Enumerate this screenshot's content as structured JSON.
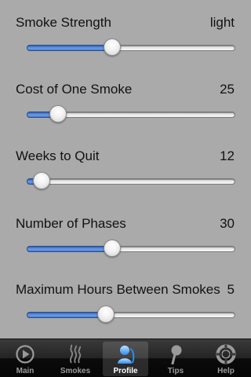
{
  "settings": [
    {
      "label": "Smoke Strength",
      "value": "light",
      "fraction": 0.41
    },
    {
      "label": "Cost of One Smoke",
      "value": "25",
      "fraction": 0.15
    },
    {
      "label": "Weeks to Quit",
      "value": "12",
      "fraction": 0.07
    },
    {
      "label": "Number of Phases",
      "value": "30",
      "fraction": 0.41
    },
    {
      "label": "Maximum Hours Between Smokes",
      "value": "5",
      "fraction": 0.38
    }
  ],
  "tabbar": {
    "selected": "Profile",
    "tabs": [
      {
        "label": "Main",
        "icon": "play-icon"
      },
      {
        "label": "Smokes",
        "icon": "smoke-icon"
      },
      {
        "label": "Profile",
        "icon": "person-icon"
      },
      {
        "label": "Tips",
        "icon": "pin-icon"
      },
      {
        "label": "Help",
        "icon": "lifebuoy-icon"
      }
    ]
  },
  "colors": {
    "background": "#aaaaaa",
    "slider_fill": "#4a7ad0",
    "tab_selected_text": "#ffffff",
    "tab_text": "#9a9a9a"
  }
}
